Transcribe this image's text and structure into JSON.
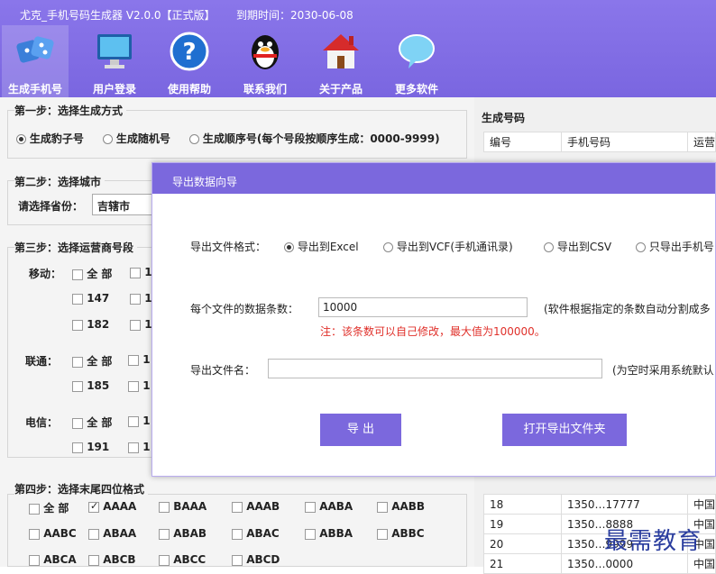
{
  "window": {
    "title": "尤克_手机号码生成器 V2.0.0【正式版】",
    "expire": "到期时间：2030-06-08"
  },
  "toolbar": {
    "items": [
      {
        "label": "生成手机号",
        "icon": "dice-icon"
      },
      {
        "label": "用户登录",
        "icon": "monitor-icon"
      },
      {
        "label": "使用帮助",
        "icon": "help-icon"
      },
      {
        "label": "联系我们",
        "icon": "penguin-icon"
      },
      {
        "label": "关于产品",
        "icon": "house-icon"
      },
      {
        "label": "更多软件",
        "icon": "chat-bubble-icon"
      }
    ]
  },
  "step1": {
    "title": "第一步：选择生成方式",
    "options": [
      "生成豹子号",
      "生成随机号",
      "生成顺序号(每个号段按顺序生成：0000-9999)"
    ]
  },
  "step2": {
    "title": "第二步：选择城市",
    "label": "请选择省份：",
    "value": "吉辖市"
  },
  "step3": {
    "title": "第三步：选择运营商号段",
    "mobile": {
      "label": "移动：",
      "all": "全 部",
      "row1_extra": "1",
      "r2": "147",
      "r2_extra": "1",
      "r3": "182",
      "r3_extra": "1"
    },
    "unicom": {
      "label": "联通：",
      "all": "全 部",
      "row1_extra": "1",
      "r2": "185",
      "r2_extra": "1"
    },
    "telecom": {
      "label": "电信：",
      "all": "全 部",
      "row1_extra": "1",
      "r2": "191",
      "r2_extra": "1"
    }
  },
  "step4": {
    "title": "第四步：选择末尾四位格式",
    "row1": [
      "全 部",
      "AAAA",
      "BAAA",
      "AAAB",
      "AABA",
      "AABB"
    ],
    "row2": [
      "AABC",
      "ABAA",
      "ABAB",
      "ABAC",
      "ABBA",
      "ABBC"
    ],
    "row3": [
      "ABCA",
      "ABCB",
      "ABCC",
      "ABCD"
    ]
  },
  "results": {
    "title": "生成号码",
    "headers": [
      "编号",
      "手机号码",
      "运营"
    ],
    "rows": [
      {
        "id": "18",
        "number": "1350…17777",
        "op": "中国"
      },
      {
        "id": "19",
        "number": "1350…8888",
        "op": "中国"
      },
      {
        "id": "20",
        "number": "1350…9999",
        "op": "中国"
      },
      {
        "id": "21",
        "number": "1350…0000",
        "op": "中国"
      }
    ]
  },
  "dialog": {
    "title": "导出数据向导",
    "format_label": "导出文件格式：",
    "formats": [
      "导出到Excel",
      "导出到VCF(手机通讯录)",
      "导出到CSV",
      "只导出手机号"
    ],
    "count_label": "每个文件的数据条数：",
    "count_value": "10000",
    "count_hint": "(软件根据指定的条数自动分割成多",
    "count_note": "注：该条数可以自己修改，最大值为100000。",
    "filename_label": "导出文件名：",
    "filename_value": "",
    "filename_hint": "(为空时采用系统默认",
    "export_button": "导  出",
    "open_folder_button": "打开导出文件夹"
  },
  "watermark": "最需教育",
  "colors": {
    "accent": "#7b68dd",
    "note": "#e0302a"
  }
}
